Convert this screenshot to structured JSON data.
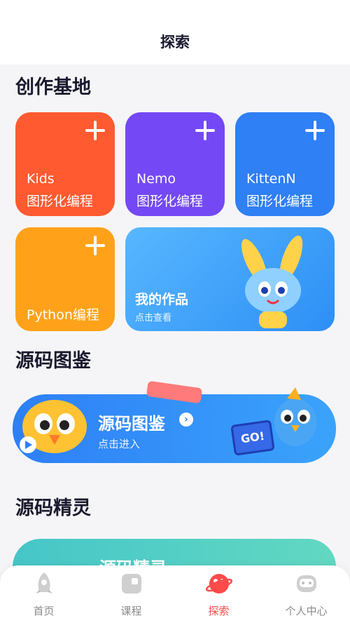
{
  "header": {
    "title": "探索"
  },
  "sections": {
    "creation": "创作基地",
    "source_book": "源码图鉴",
    "source_spirit": "源码精灵"
  },
  "cards": {
    "kids": {
      "line1": "Kids",
      "line2": "图形化编程"
    },
    "nemo": {
      "line1": "Nemo",
      "line2": "图形化编程"
    },
    "kitten": {
      "line1": "KittenN",
      "line2": "图形化编程"
    },
    "python": {
      "label": "Python编程"
    },
    "works": {
      "title": "我的作品",
      "subtitle": "点击查看"
    }
  },
  "banner_source_book": {
    "title": "源码图鉴",
    "subtitle": "点击进入",
    "go": "GO!"
  },
  "banner_source_spirit": {
    "title": "源码精灵"
  },
  "tabs": [
    {
      "label": "首页",
      "icon": "rocket-icon"
    },
    {
      "label": "课程",
      "icon": "book-icon"
    },
    {
      "label": "探索",
      "icon": "planet-icon"
    },
    {
      "label": "个人中心",
      "icon": "robot-icon"
    }
  ],
  "colors": {
    "kids": "#ff5a30",
    "nemo": "#7449f5",
    "kitten": "#2f7ff5",
    "python": "#ffa21a",
    "works": "#3aa3fb",
    "active_tab": "#ff4a4a"
  }
}
